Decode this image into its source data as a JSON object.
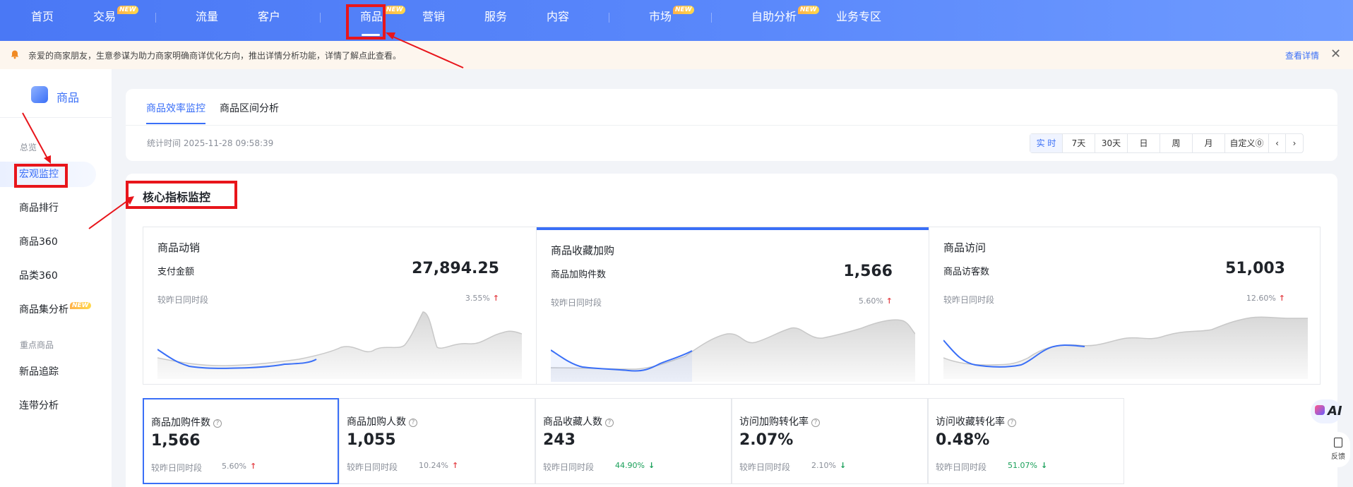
{
  "nav": {
    "items": [
      {
        "label": "首页",
        "new": ""
      },
      {
        "label": "交易",
        "new": "NEW"
      },
      {
        "label": "流量",
        "new": ""
      },
      {
        "label": "客户",
        "new": ""
      },
      {
        "label": "商品",
        "new": "NEW"
      },
      {
        "label": "营销",
        "new": ""
      },
      {
        "label": "服务",
        "new": ""
      },
      {
        "label": "内容",
        "new": ""
      },
      {
        "label": "市场",
        "new": "NEW"
      },
      {
        "label": "自助分析",
        "new": "NEW"
      },
      {
        "label": "业务专区",
        "new": ""
      }
    ]
  },
  "notice": {
    "text": "亲爱的商家朋友，生意参谋为助力商家明确商详优化方向，推出详情分析功能，详情了解点此查看。",
    "link": "查看详情",
    "close": "✕"
  },
  "sidebar": {
    "title": "商品",
    "groups": [
      {
        "label": "总览"
      },
      {
        "label": "重点商品"
      }
    ],
    "items": [
      {
        "label": "宏观监控",
        "active": true
      },
      {
        "label": "商品排行"
      },
      {
        "label": "商品360"
      },
      {
        "label": "品类360"
      },
      {
        "label": "商品集分析",
        "new": "NEW"
      },
      {
        "label": "新品追踪"
      },
      {
        "label": "连带分析"
      }
    ]
  },
  "tabs": [
    {
      "label": "商品效率监控",
      "active": true
    },
    {
      "label": "商品区间分析"
    }
  ],
  "stat_time": "统计时间 2025-11-28 09:58:39",
  "ranges": [
    "实 时",
    "7天",
    "30天",
    "日",
    "周",
    "月",
    "自定义⓪",
    "‹",
    "›"
  ],
  "section_title": "核心指标监控",
  "panels": [
    {
      "title": "商品动销",
      "label": "支付金额",
      "value": "27,894.25",
      "compare": "较昨日同时段",
      "pct": "3.55%",
      "trend": "↑"
    },
    {
      "title": "商品收藏加购",
      "label": "商品加购件数",
      "value": "1,566",
      "compare": "较昨日同时段",
      "pct": "5.60%",
      "trend": "↑"
    },
    {
      "title": "商品访问",
      "label": "商品访客数",
      "value": "51,003",
      "compare": "较昨日同时段",
      "pct": "12.60%",
      "trend": "↑"
    }
  ],
  "metrics": [
    {
      "title": "商品加购件数",
      "value": "1,566",
      "compare": "较昨日同时段",
      "pct": "5.60%",
      "dir": "up"
    },
    {
      "title": "商品加购人数",
      "value": "1,055",
      "compare": "较昨日同时段",
      "pct": "10.24%",
      "dir": "up"
    },
    {
      "title": "商品收藏人数",
      "value": "243",
      "compare": "较昨日同时段",
      "pct": "44.90%",
      "dir": "down"
    },
    {
      "title": "访问加购转化率",
      "value": "2.07%",
      "compare": "较昨日同时段",
      "pct": "2.10%",
      "dir": "down"
    },
    {
      "title": "访问收藏转化率",
      "value": "0.48%",
      "compare": "较昨日同时段",
      "pct": "51.07%",
      "dir": "down"
    }
  ],
  "floating": {
    "ai": "AI",
    "feedback": "反馈"
  },
  "colors": {
    "accent": "#3a6ff7",
    "highlight": "#e8151b",
    "up": "#e5484d",
    "down": "#1aa05a"
  }
}
